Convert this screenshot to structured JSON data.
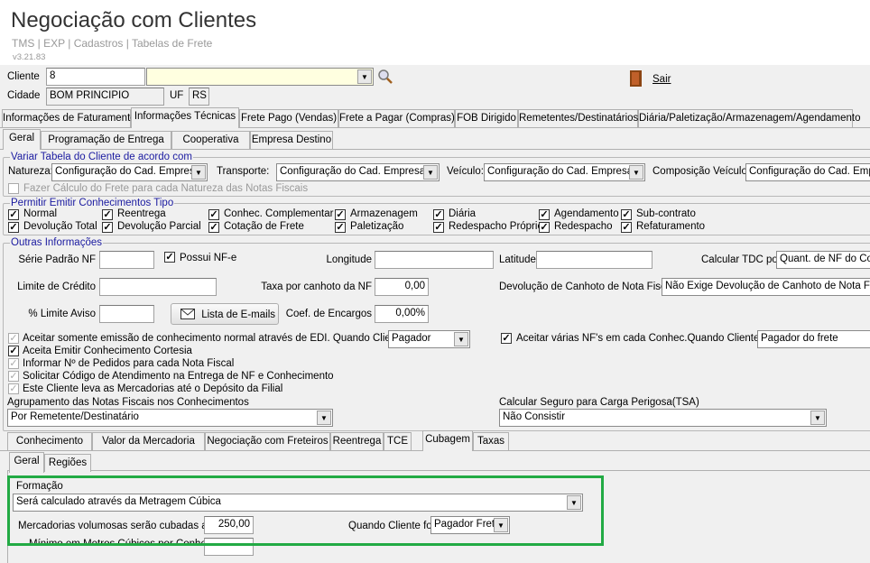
{
  "header": {
    "title": "Negociação com Clientes",
    "breadcrumb": "TMS | EXP | Cadastros | Tabelas de Frete",
    "version": "v3.21.83"
  },
  "cliente": {
    "label": "Cliente",
    "code": "8",
    "name": "",
    "cidade_label": "Cidade",
    "cidade": "BOM PRINCIPIO",
    "uf_label": "UF",
    "uf": "RS",
    "sair": "Sair"
  },
  "main_tabs": [
    "Informações de Faturamento",
    "Informações Técnicas",
    "Frete Pago (Vendas)",
    "Frete a Pagar (Compras)",
    "FOB Dirigido",
    "Remetentes/Destinatários",
    "Diária/Paletização/Armazenagem/Agendamento"
  ],
  "sub_tabs": [
    "Geral",
    "Programação de Entrega",
    "Cooperativa",
    "Empresa Destino"
  ],
  "variar": {
    "title": "Variar Tabela do Cliente de acordo com",
    "natureza_label": "Natureza:",
    "natureza": "Configuração do Cad. Empresas",
    "transporte_label": "Transporte:",
    "transporte": "Configuração do Cad. Empresas",
    "veiculo_label": "Veículo:",
    "veiculo": "Configuração do Cad. Empresas",
    "composicao_label": "Composição Veículo",
    "composicao": "Configuração do Cad. Empresas",
    "calc_label": "Fazer Cálculo do Frete para cada Natureza das Notas Fiscais"
  },
  "permitir": {
    "title": "Permitir Emitir Conhecimentos Tipo",
    "items": [
      "Normal",
      "Reentrega",
      "Conhec. Complementar",
      "Armazenagem",
      "Diária",
      "Agendamento",
      "Sub-contrato",
      "Devolução Total",
      "Devolução Parcial",
      "Cotação de Frete",
      "Paletização",
      "Redespacho Próprio",
      "Redespacho",
      "Refaturamento"
    ]
  },
  "outras": {
    "title": "Outras Informações",
    "serie_label": "Série Padrão NF",
    "serie": "",
    "possui_nfe": "Possui NF-e",
    "longitude_label": "Longitude",
    "longitude": "",
    "latitude_label": "Latitude",
    "latitude": "",
    "tdc_label": "Calcular TDC por",
    "tdc": "Quant. de NF do Conhecimento",
    "limite_label": "Limite de Crédito",
    "limite": "",
    "taxa_label": "Taxa por canhoto da NF",
    "taxa": "0,00",
    "devolucao_label": "Devolução de Canhoto de Nota Fiscal",
    "devolucao": "Não Exige Devolução de Canhoto de Nota Fiscal",
    "aviso_label": "% Limite Aviso",
    "aviso": "",
    "emails_button": "Lista de E-mails",
    "coef_label": "Coef. de Encargos",
    "coef": "0,00%",
    "edi_label": "Aceitar somente emissão de conhecimento normal através de EDI. Quando Cliente for",
    "edi": "Pagador",
    "varias_label": "Aceitar várias NF's em cada Conhec.Quando Cliente for",
    "varias": "Pagador do frete",
    "checks": [
      "Aceita Emitir Conhecimento Cortesia",
      "Informar Nº de Pedidos para cada Nota Fiscal",
      "Solicitar Código de Atendimento na Entrega de NF e Conhecimento",
      "Este Cliente leva as Mercadorias até o Depósito da Filial"
    ],
    "agrup_label": "Agrupamento das Notas Fiscais nos Conhecimentos",
    "agrup": "Por Remetente/Destinatário",
    "seguro_label": "Calcular Seguro para Carga Perigosa(TSA)",
    "seguro": "Não Consistir"
  },
  "bottom_tabs": [
    "Conhecimento",
    "Valor da Mercadoria",
    "Negociação com Freteiros",
    "Reentrega",
    "TCE",
    "Cubagem",
    "Taxas"
  ],
  "inner_tabs": [
    "Geral",
    "Regiões"
  ],
  "cubagem": {
    "formacao_label": "Formação",
    "formacao": "Será calculado através da Metragem Cúbica",
    "volumosas_label": "Mercadorias volumosas serão cubadas a",
    "volumosas": "250,00",
    "quando_label": "Quando Cliente for",
    "quando": "Pagador Frete",
    "minimo_label": "Mínimo em Metros Cúbicos por Conhec.",
    "minimo": ""
  },
  "colors": {
    "highlight": "#22aa44",
    "combo_bg": "#ffffe0",
    "group_label": "#1a1aa0"
  }
}
